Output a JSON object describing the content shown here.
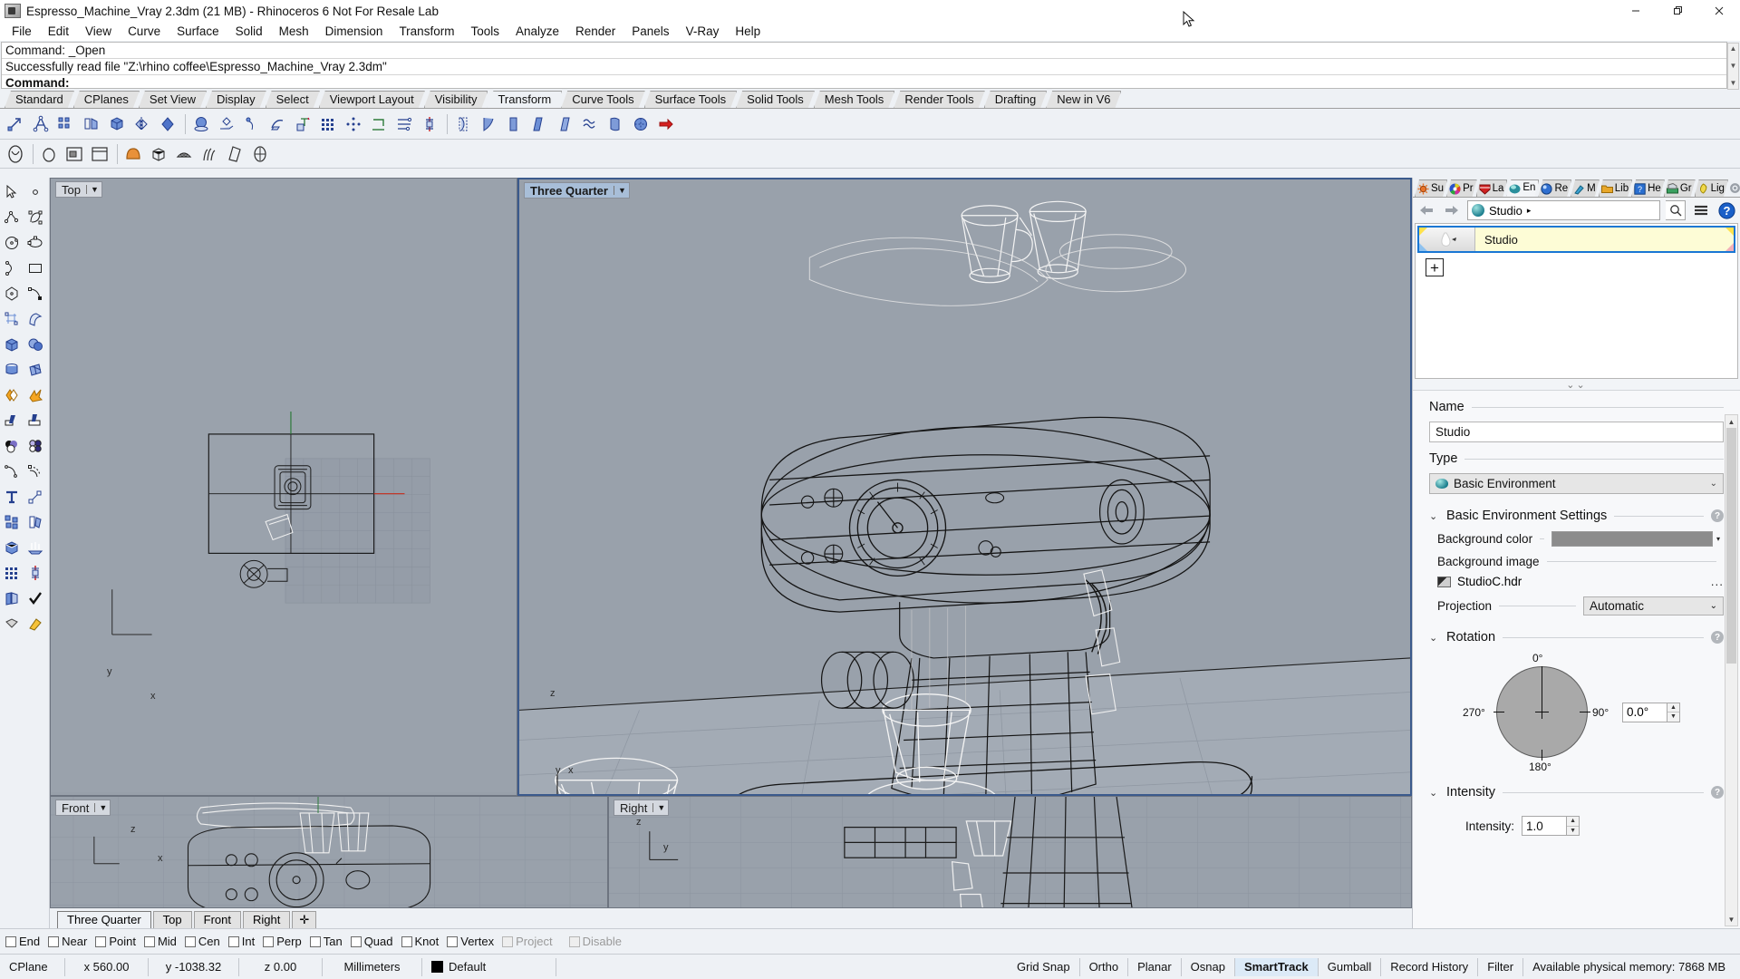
{
  "window": {
    "title": "Espresso_Machine_Vray 2.3dm (21 MB) - Rhinoceros 6 Not For Resale Lab",
    "minimize": "—",
    "maximize": "❐",
    "close": "✕"
  },
  "menubar": {
    "items": [
      "File",
      "Edit",
      "View",
      "Curve",
      "Surface",
      "Solid",
      "Mesh",
      "Dimension",
      "Transform",
      "Tools",
      "Analyze",
      "Render",
      "Panels",
      "V-Ray",
      "Help"
    ]
  },
  "command_pane": {
    "lines": [
      "Command: _Open",
      "Successfully read file \"Z:\\rhino coffee\\Espresso_Machine_Vray 2.3dm\"",
      "Command:"
    ],
    "prompt": "Command:"
  },
  "toolbar_tabs": {
    "items": [
      "Standard",
      "CPlanes",
      "Set View",
      "Display",
      "Select",
      "Viewport Layout",
      "Visibility",
      "Transform",
      "Curve Tools",
      "Surface Tools",
      "Solid Tools",
      "Mesh Tools",
      "Render Tools",
      "Drafting",
      "New in V6"
    ],
    "active": "Transform"
  },
  "viewports": {
    "top_left": {
      "label": "Top",
      "active": false
    },
    "top_right": {
      "label": "Three Quarter",
      "active": true
    },
    "bottom_left": {
      "label": "Front",
      "active": false
    },
    "bottom_right": {
      "label": "Right",
      "active": false
    },
    "axis_labels": {
      "x": "x",
      "y": "y",
      "z": "z"
    }
  },
  "viewport_tabs": {
    "items": [
      "Three Quarter",
      "Top",
      "Front",
      "Right"
    ],
    "active": "Three Quarter",
    "add": "✛"
  },
  "right_panel": {
    "tabs": [
      {
        "label": "Su",
        "icon": "sun-icon",
        "active": false
      },
      {
        "label": "Pr",
        "icon": "color-wheel-icon",
        "active": false
      },
      {
        "label": "La",
        "icon": "layers-icon",
        "active": false
      },
      {
        "label": "En",
        "icon": "environment-icon",
        "active": true
      },
      {
        "label": "Re",
        "icon": "render-icon",
        "active": false
      },
      {
        "label": "M",
        "icon": "material-icon",
        "active": false
      },
      {
        "label": "Lib",
        "icon": "folder-icon",
        "active": false
      },
      {
        "label": "He",
        "icon": "help-icon",
        "active": false
      },
      {
        "label": "Gr",
        "icon": "ground-plane-icon",
        "active": false
      },
      {
        "label": "Lig",
        "icon": "light-bulb-icon",
        "active": false
      }
    ],
    "nav": {
      "back": "←",
      "forward": "→",
      "breadcrumb": "Studio",
      "breadcrumb_arrow": "▸",
      "search": "search-icon",
      "menu": "hamburger-icon",
      "help": "?"
    },
    "environment_list": [
      {
        "name": "Studio",
        "selected": true
      }
    ],
    "add_button": "+",
    "properties": {
      "name_group": "Name",
      "name_value": "Studio",
      "type_group": "Type",
      "type_value": "Basic Environment",
      "basic_settings_group": "Basic Environment Settings",
      "background_color_label": "Background color",
      "background_color_value": "#8c8c8c",
      "background_image_label": "Background image",
      "background_image_file": "StudioC.hdr",
      "background_image_browse": "...",
      "projection_label": "Projection",
      "projection_value": "Automatic",
      "rotation_group": "Rotation",
      "rotation_ticks": {
        "top": "0°",
        "right": "90°",
        "bottom": "180°",
        "left": "270°"
      },
      "rotation_value": "0.0°",
      "intensity_group": "Intensity",
      "intensity_label": "Intensity:",
      "intensity_value": "1.0"
    }
  },
  "osnap_bar": {
    "items": [
      {
        "label": "End",
        "checked": false,
        "enabled": true
      },
      {
        "label": "Near",
        "checked": false,
        "enabled": true
      },
      {
        "label": "Point",
        "checked": false,
        "enabled": true
      },
      {
        "label": "Mid",
        "checked": false,
        "enabled": true
      },
      {
        "label": "Cen",
        "checked": false,
        "enabled": true
      },
      {
        "label": "Int",
        "checked": false,
        "enabled": true
      },
      {
        "label": "Perp",
        "checked": false,
        "enabled": true
      },
      {
        "label": "Tan",
        "checked": false,
        "enabled": true
      },
      {
        "label": "Quad",
        "checked": false,
        "enabled": true
      },
      {
        "label": "Knot",
        "checked": false,
        "enabled": true
      },
      {
        "label": "Vertex",
        "checked": false,
        "enabled": true
      },
      {
        "label": "Project",
        "checked": false,
        "enabled": false
      },
      {
        "label": "Disable",
        "checked": false,
        "enabled": false
      }
    ]
  },
  "status_bar": {
    "cplane": "CPlane",
    "x": "x 560.00",
    "y": "y -1038.32",
    "z": "z 0.00",
    "units": "Millimeters",
    "layer": "Default",
    "toggles": [
      "Grid Snap",
      "Ortho",
      "Planar",
      "Osnap",
      "SmartTrack",
      "Gumball",
      "Record History",
      "Filter"
    ],
    "active_toggle": "SmartTrack",
    "memory": "Available physical memory: 7868 MB"
  }
}
